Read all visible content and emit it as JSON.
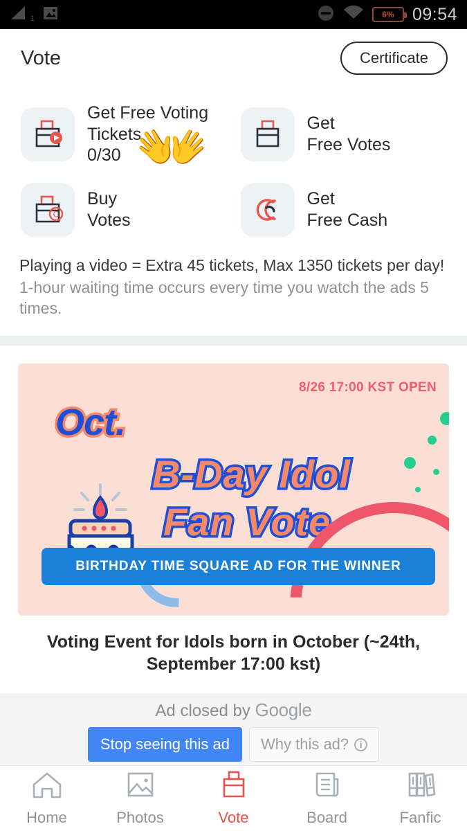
{
  "status_bar": {
    "signal_icon": "signal-bars-icon",
    "sim_label": "1",
    "image_icon": "photo-icon",
    "dnd_icon": "do-not-disturb-icon",
    "wifi_icon": "wifi-icon",
    "battery_percent": "6%",
    "time": "09:54"
  },
  "header": {
    "title": "Vote",
    "certificate_label": "Certificate"
  },
  "menu": {
    "tiles": [
      {
        "label": "Get Free Voting\nTickets\n0/30",
        "icon": "ballot-box-play-icon"
      },
      {
        "label": "Get\nFree Votes",
        "icon": "ballot-box-icon"
      },
      {
        "label": "Buy\nVotes",
        "icon": "ballot-box-coin-icon"
      },
      {
        "label": "Get\nFree Cash",
        "icon": "cash-c-icon"
      }
    ],
    "overlay_emoji": "👐"
  },
  "notice": {
    "main": "Playing a video = Extra 45 tickets, Max 1350 tickets per day!",
    "sub": "1-hour waiting time occurs every time you watch the ads 5 times."
  },
  "banner": {
    "date_badge": "8/26 17:00 KST OPEN",
    "month": "Oct.",
    "title_line1": "B-Day Idol",
    "title_line2": "Fan Vote",
    "winner_bar": "BIRTHDAY TIME SQUARE AD FOR THE WINNER",
    "bg_color": "#fbdfd5",
    "accent_blue": "#1e4fd6",
    "accent_coral": "#f58a6b",
    "accent_red": "#f0566b",
    "accent_green": "#25cf92",
    "bar_blue": "#1b80d8"
  },
  "event": {
    "title": "Voting Event for Idols born in October (~24th, September 17:00 kst)"
  },
  "ad_bar": {
    "closed_text": "Ad closed by ",
    "brand": "Google",
    "stop_label": "Stop seeing this ad",
    "why_label": "Why this ad?",
    "info_icon": "info-icon",
    "stop_color": "#4285f4"
  },
  "bottom_nav": {
    "items": [
      {
        "label": "Home",
        "icon": "home-icon",
        "active": false
      },
      {
        "label": "Photos",
        "icon": "photos-icon",
        "active": false
      },
      {
        "label": "Vote",
        "icon": "ballot-box-icon",
        "active": true
      },
      {
        "label": "Board",
        "icon": "board-icon",
        "active": false
      },
      {
        "label": "Fanfic",
        "icon": "books-icon",
        "active": false
      }
    ],
    "active_color": "#e85252",
    "inactive_color": "#8e9599"
  }
}
